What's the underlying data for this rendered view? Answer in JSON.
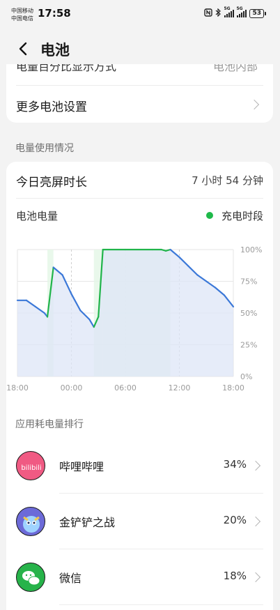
{
  "status_bar": {
    "carrier1": "中国移动",
    "carrier2": "中国电信",
    "time": "17:58",
    "sig1_label": "5G",
    "sig2_label": "5G",
    "battery": "53"
  },
  "header": {
    "title": "电池"
  },
  "settings_card": {
    "partial_row_label": "电量百分比显示方式",
    "partial_row_value": "电池内部",
    "more_settings_label": "更多电池设置"
  },
  "usage": {
    "section_title": "电量使用情况",
    "screen_time_label": "今日亮屏时长",
    "screen_time_value": "7 小时 54 分钟",
    "battery_level_label": "电池电量",
    "legend_charging": "充电时段"
  },
  "chart_data": {
    "type": "area",
    "x_ticks": [
      "18:00",
      "00:00",
      "06:00",
      "12:00",
      "18:00"
    ],
    "y_ticks": [
      "100%",
      "75%",
      "50%",
      "25%",
      "0%"
    ],
    "ylim": [
      0,
      100
    ],
    "grid": true,
    "legend": "top-right",
    "colors": {
      "discharging": "#3b78d8",
      "charging": "#20b44a"
    },
    "series": [
      {
        "name": "充电时段",
        "x": [
          "18:00",
          "19:00",
          "20:00",
          "21:00",
          "21:20",
          "22:00",
          "23:00",
          "00:00",
          "01:00",
          "02:00",
          "02:30",
          "03:00",
          "03:30",
          "06:00",
          "09:00",
          "10:00",
          "10:30",
          "11:00",
          "12:00",
          "13:00",
          "14:00",
          "15:00",
          "16:00",
          "17:00",
          "18:00"
        ],
        "y": [
          60,
          60,
          55,
          50,
          47,
          86,
          80,
          65,
          52,
          45,
          39,
          47,
          100,
          100,
          100,
          100,
          99,
          100,
          94,
          87,
          80,
          75,
          70,
          64,
          55
        ]
      }
    ],
    "charging_periods": [
      [
        "21:20",
        "22:00"
      ],
      [
        "02:30",
        "03:30"
      ],
      [
        "03:30",
        "11:00"
      ]
    ]
  },
  "ranking": {
    "section_title": "应用耗电量排行",
    "apps": [
      {
        "name": "哔哩哔哩",
        "percent": "34%",
        "icon": "bilibili-icon",
        "icon_text": "bilibili"
      },
      {
        "name": "金铲铲之战",
        "percent": "20%",
        "icon": "jinchanchan-icon"
      },
      {
        "name": "微信",
        "percent": "18%",
        "icon": "wechat-icon"
      }
    ]
  }
}
